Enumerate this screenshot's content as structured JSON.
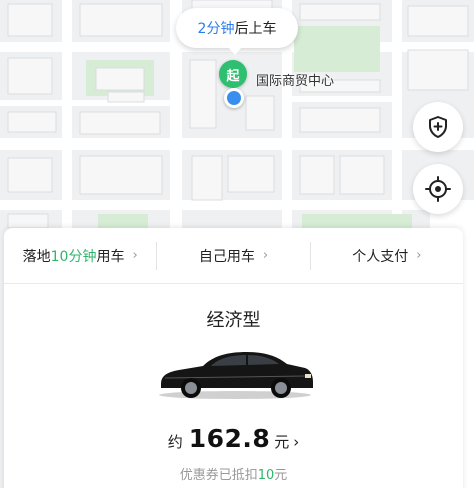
{
  "map": {
    "pickup_bubble": {
      "minutes_text": "2分钟",
      "suffix_text": "后上车"
    },
    "start_marker": {
      "label": "起"
    },
    "place_label": "国际商贸中心",
    "buttons": {
      "safety": "shield-plus-icon",
      "locate": "locate-icon"
    }
  },
  "colors": {
    "accent_green": "#2fb56b",
    "accent_blue": "#2b7de9",
    "map_bg": "#eef0f2"
  },
  "options": [
    {
      "prefix": "落地",
      "highlight": "10分钟",
      "suffix": "用车"
    },
    {
      "label": "自己用车"
    },
    {
      "label": "个人支付"
    }
  ],
  "ride": {
    "car_type": "经济型",
    "price_prefix": "约",
    "price": "162.8",
    "price_unit": "元",
    "discount_prefix": "优惠券已抵扣",
    "discount_amount": "10",
    "discount_unit": "元"
  }
}
